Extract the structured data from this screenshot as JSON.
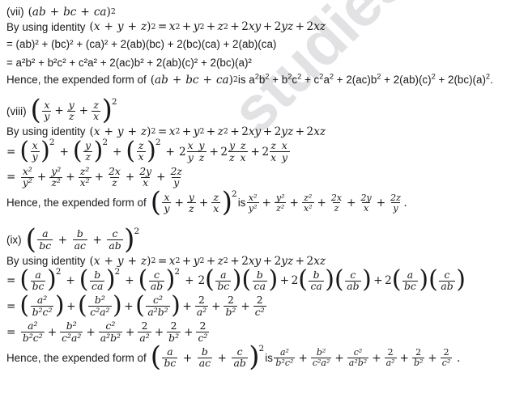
{
  "document": {
    "type": "math-solution-worksheet",
    "watermark": "studiestoday.com",
    "identity_label": "By using identity",
    "hence_label": "Hence, the expended form of",
    "is_label": "is",
    "eq": "=",
    "plus": "+"
  },
  "sections": [
    {
      "id": "vii",
      "label": "(vii)",
      "question": "(ab + bc + ca)²",
      "identity": "By using identity (x + y + z)² = x² + y² + z² + 2xy + 2yz + 2xz",
      "steps": [
        "= (ab)² + (bc)² + (ca)² + 2(ab)(bc) + 2(bc)(ca) + 2(ab)(ca)",
        "= a²b² + b²c² + c²a² + 2(ac)b² + 2(ab)(c)² + 2(bc)(a)²"
      ],
      "conclusion": "Hence, the expended form of (ab + bc + ca)² is a²b² + b²c² + c²a² + 2(ac)b² + 2(ab)(c)² + 2(bc)(a)².",
      "terms": {
        "t1": "ab",
        "t2": "bc",
        "t3": "ca",
        "s1n": "ab",
        "s2n": "bc",
        "s3n": "ca",
        "p1": "ab",
        "p2": "bc",
        "p3": "bc",
        "p4": "ca",
        "p5": "ab",
        "p6": "ca"
      }
    },
    {
      "id": "viii",
      "label": "(viii)",
      "question": "(x/y + y/z + z/x)²",
      "identity": "By using identity (x + y + z)² = x² + y² + z² + 2xy + 2yz + 2xz",
      "steps": [
        "= (x/y)² + (y/z)² + (z/x)² + 2(xy/yz) + 2(yz/zx) + 2(zx/xy)",
        "= x²/y² + y²/z² + z²/x² + 2x/z + 2y/x + 2z/y"
      ],
      "conclusion": "Hence, the expended form of (x/y + y/z + z/x)² is x²/y² + y²/z² + z²/x² + 2x/z + 2y/x + 2z/y.",
      "fractions": [
        {
          "n": "x",
          "d": "y"
        },
        {
          "n": "y",
          "d": "z"
        },
        {
          "n": "z",
          "d": "x"
        }
      ],
      "cross": [
        {
          "n": "x y",
          "d": "y z"
        },
        {
          "n": "y z",
          "d": "z x"
        },
        {
          "n": "z x",
          "d": "x y"
        }
      ],
      "squared": [
        {
          "n": "x²",
          "d": "y²"
        },
        {
          "n": "y²",
          "d": "z²"
        },
        {
          "n": "z²",
          "d": "x²"
        }
      ],
      "doubles": [
        {
          "n": "2x",
          "d": "z"
        },
        {
          "n": "2y",
          "d": "x"
        },
        {
          "n": "2z",
          "d": "y"
        }
      ]
    },
    {
      "id": "ix",
      "label": "(ix)",
      "question": "(a/bc + b/ac + c/ab)²",
      "identity": "By using identity (x + y + z)² = x² + y² + z² + 2xy + 2yz + 2xz",
      "steps": [
        "= (a/bc)² + (b/ca)² + (c/ab)² + 2(a/bc)(b/ca) + 2(b/ca)(c/ab) + 2(a/bc)(c/ab)",
        "= (a²/b²c²) + (b²/c²a²) + (c²/a²b²) + 2/a² + 2/b² + 2/c²",
        "= a²/b²c² + b²/c²a² + c²/a²b² + 2/a² + 2/b² + 2/c²"
      ],
      "conclusion": "Hence, the expended form of (a/bc + b/ac + c/ab)² is a²/b²c² + b²/c²a² + c²/a²b² + 2/a² + 2/b² + 2/c².",
      "question_fracs": [
        {
          "n": "a",
          "d": "bc"
        },
        {
          "n": "b",
          "d": "ac"
        },
        {
          "n": "c",
          "d": "ab"
        }
      ],
      "sq_fracs": [
        {
          "n": "a",
          "d": "bc"
        },
        {
          "n": "b",
          "d": "ca"
        },
        {
          "n": "c",
          "d": "ab"
        }
      ],
      "cross_pairs": [
        [
          {
            "n": "a",
            "d": "bc"
          },
          {
            "n": "b",
            "d": "ca"
          }
        ],
        [
          {
            "n": "b",
            "d": "ca"
          },
          {
            "n": "c",
            "d": "ab"
          }
        ],
        [
          {
            "n": "a",
            "d": "bc"
          },
          {
            "n": "c",
            "d": "ab"
          }
        ]
      ],
      "expanded": [
        {
          "n": "a²",
          "d": "b²c²"
        },
        {
          "n": "b²",
          "d": "c²a²"
        },
        {
          "n": "c²",
          "d": "a²b²"
        }
      ],
      "twos": [
        {
          "n": "2",
          "d": "a²"
        },
        {
          "n": "2",
          "d": "b²"
        },
        {
          "n": "2",
          "d": "c²"
        }
      ]
    }
  ],
  "identity_parts": {
    "open": "(",
    "x": "x",
    "y": "y",
    "z": "z",
    "close": ")",
    "two": "2",
    "rhs": [
      "x",
      "y",
      "z"
    ],
    "cross": [
      "2xy",
      "2yz",
      "2xz"
    ]
  },
  "colors": {
    "text": "#17181c",
    "watermark": "#e2e2e4",
    "background": "#ffffff"
  }
}
